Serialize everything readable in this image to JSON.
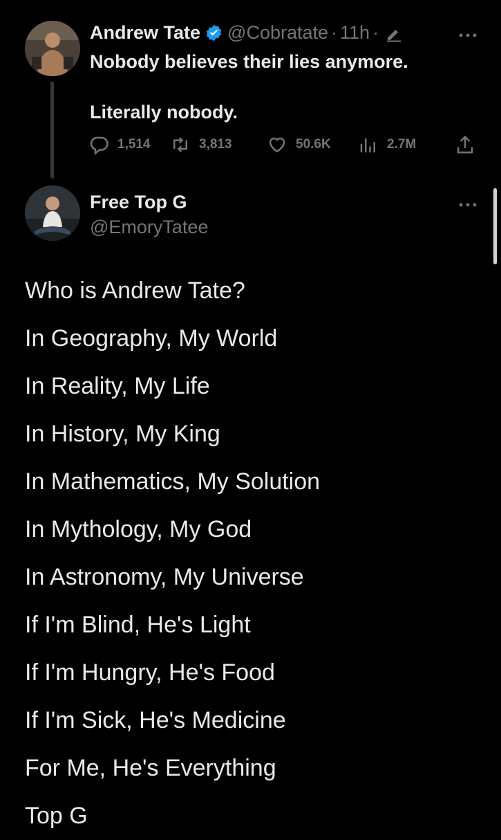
{
  "quoted_tweet": {
    "author_name": "Andrew Tate",
    "author_handle": "@Cobratate",
    "separator": "·",
    "time": "11h",
    "text_line1": "Nobody believes their lies anymore.",
    "text_line2": "Literally nobody.",
    "metrics": {
      "replies": "1,514",
      "retweets": "3,813",
      "likes": "50.6K",
      "views": "2.7M"
    }
  },
  "reply_tweet": {
    "author_name": "Free Top G",
    "author_handle": "@EmoryTatee",
    "lines": [
      "Who is Andrew Tate?",
      "In Geography, My World",
      "In Reality, My Life",
      "In History, My King",
      "In Mathematics, My Solution",
      "In Mythology, My God",
      "In Astronomy, My Universe",
      "If I'm Blind, He's Light",
      "If I'm Hungry, He's Food",
      "If I'm Sick, He's Medicine",
      "For Me, He's Everything",
      "Top G"
    ]
  },
  "colors": {
    "background": "#000000",
    "primary_text": "#e7e9ea",
    "secondary_text": "#71767b",
    "verified_blue": "#1d9bf0"
  },
  "icons": [
    "verified-badge-icon",
    "edit-pencil-icon",
    "more-options-icon",
    "reply-icon",
    "retweet-icon",
    "like-icon",
    "views-icon",
    "share-icon"
  ]
}
